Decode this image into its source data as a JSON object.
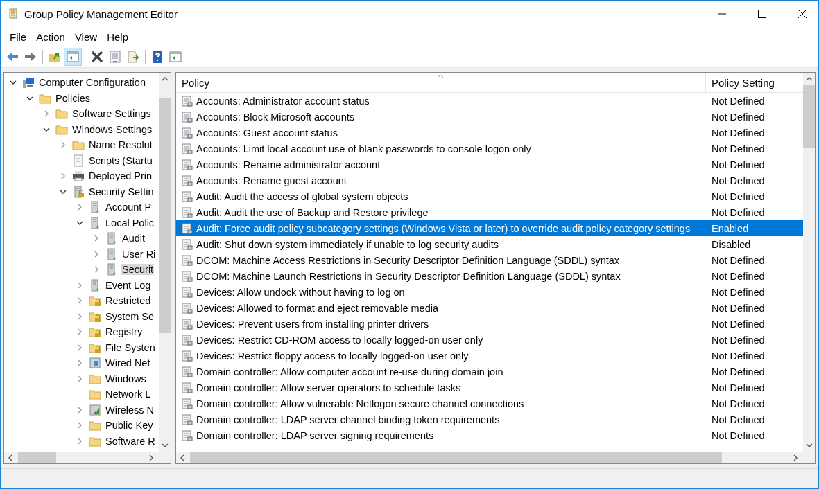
{
  "window": {
    "title": "Group Policy Management Editor"
  },
  "menu": [
    "File",
    "Action",
    "View",
    "Help"
  ],
  "toolbar": [
    {
      "kind": "back"
    },
    {
      "kind": "forward"
    },
    {
      "kind": "sep"
    },
    {
      "kind": "up"
    },
    {
      "kind": "showhide",
      "selected": true
    },
    {
      "kind": "sep"
    },
    {
      "kind": "delete"
    },
    {
      "kind": "properties"
    },
    {
      "kind": "export"
    },
    {
      "kind": "sep"
    },
    {
      "kind": "help"
    },
    {
      "kind": "pane"
    }
  ],
  "tree": [
    {
      "label": "Computer Configuration",
      "kind": "computer",
      "expanded": true,
      "selected": false,
      "children": [
        {
          "label": "Policies",
          "kind": "folder",
          "expanded": true,
          "selected": false,
          "children": [
            {
              "label": "Software Settings",
              "kind": "folder",
              "expanded": false,
              "selected": false
            },
            {
              "label": "Windows Settings",
              "kind": "folder",
              "expanded": true,
              "selected": false,
              "children": [
                {
                  "label": "Name Resolut",
                  "kind": "folder",
                  "expanded": false,
                  "selected": false
                },
                {
                  "label": "Scripts (Startu",
                  "kind": "script",
                  "selected": false
                },
                {
                  "label": "Deployed Prin",
                  "kind": "printer",
                  "expanded": false,
                  "selected": false
                },
                {
                  "label": "Security Settin",
                  "kind": "lockserver",
                  "expanded": true,
                  "selected": false,
                  "children": [
                    {
                      "label": "Account P",
                      "kind": "server",
                      "expanded": false,
                      "selected": false
                    },
                    {
                      "label": "Local Polic",
                      "kind": "server",
                      "expanded": true,
                      "selected": false,
                      "children": [
                        {
                          "label": "Audit",
                          "kind": "server",
                          "expanded": false,
                          "selected": false
                        },
                        {
                          "label": "User Ri",
                          "kind": "server",
                          "expanded": false,
                          "selected": false
                        },
                        {
                          "label": "Securit",
                          "kind": "server",
                          "expanded": false,
                          "selected": true
                        }
                      ]
                    },
                    {
                      "label": "Event Log",
                      "kind": "server",
                      "expanded": false,
                      "selected": false
                    },
                    {
                      "label": "Restricted",
                      "kind": "lockfolder",
                      "expanded": false,
                      "selected": false
                    },
                    {
                      "label": "System Se",
                      "kind": "lockfolder",
                      "expanded": false,
                      "selected": false
                    },
                    {
                      "label": "Registry",
                      "kind": "lockfolder",
                      "expanded": false,
                      "selected": false
                    },
                    {
                      "label": "File Systen",
                      "kind": "lockfolder",
                      "expanded": false,
                      "selected": false
                    },
                    {
                      "label": "Wired Net",
                      "kind": "network",
                      "expanded": false,
                      "selected": false
                    },
                    {
                      "label": "Windows",
                      "kind": "folder",
                      "expanded": false,
                      "selected": false
                    },
                    {
                      "label": "Network L",
                      "kind": "folder",
                      "selected": false
                    },
                    {
                      "label": "Wireless N",
                      "kind": "wireless",
                      "expanded": false,
                      "selected": false
                    },
                    {
                      "label": "Public Key",
                      "kind": "folder",
                      "expanded": false,
                      "selected": false
                    },
                    {
                      "label": "Software R",
                      "kind": "folder",
                      "expanded": false,
                      "selected": false
                    }
                  ]
                }
              ]
            }
          ]
        }
      ]
    }
  ],
  "table": {
    "columns": [
      "Policy",
      "Policy Setting"
    ],
    "rows": [
      {
        "policy": "Accounts: Administrator account status",
        "setting": "Not Defined",
        "selected": false
      },
      {
        "policy": "Accounts: Block Microsoft accounts",
        "setting": "Not Defined",
        "selected": false
      },
      {
        "policy": "Accounts: Guest account status",
        "setting": "Not Defined",
        "selected": false
      },
      {
        "policy": "Accounts: Limit local account use of blank passwords to console logon only",
        "setting": "Not Defined",
        "selected": false
      },
      {
        "policy": "Accounts: Rename administrator account",
        "setting": "Not Defined",
        "selected": false
      },
      {
        "policy": "Accounts: Rename guest account",
        "setting": "Not Defined",
        "selected": false
      },
      {
        "policy": "Audit: Audit the access of global system objects",
        "setting": "Not Defined",
        "selected": false
      },
      {
        "policy": "Audit: Audit the use of Backup and Restore privilege",
        "setting": "Not Defined",
        "selected": false
      },
      {
        "policy": "Audit: Force audit policy subcategory settings (Windows Vista or later) to override audit policy category settings",
        "setting": "Enabled",
        "selected": true
      },
      {
        "policy": "Audit: Shut down system immediately if unable to log security audits",
        "setting": "Disabled",
        "selected": false
      },
      {
        "policy": "DCOM: Machine Access Restrictions in Security Descriptor Definition Language (SDDL) syntax",
        "setting": "Not Defined",
        "selected": false
      },
      {
        "policy": "DCOM: Machine Launch Restrictions in Security Descriptor Definition Language (SDDL) syntax",
        "setting": "Not Defined",
        "selected": false
      },
      {
        "policy": "Devices: Allow undock without having to log on",
        "setting": "Not Defined",
        "selected": false
      },
      {
        "policy": "Devices: Allowed to format and eject removable media",
        "setting": "Not Defined",
        "selected": false
      },
      {
        "policy": "Devices: Prevent users from installing printer drivers",
        "setting": "Not Defined",
        "selected": false
      },
      {
        "policy": "Devices: Restrict CD-ROM access to locally logged-on user only",
        "setting": "Not Defined",
        "selected": false
      },
      {
        "policy": "Devices: Restrict floppy access to locally logged-on user only",
        "setting": "Not Defined",
        "selected": false
      },
      {
        "policy": "Domain controller: Allow computer account re-use during domain join",
        "setting": "Not Defined",
        "selected": false
      },
      {
        "policy": "Domain controller: Allow server operators to schedule tasks",
        "setting": "Not Defined",
        "selected": false
      },
      {
        "policy": "Domain controller: Allow vulnerable Netlogon secure channel connections",
        "setting": "Not Defined",
        "selected": false
      },
      {
        "policy": "Domain controller: LDAP server channel binding token requirements",
        "setting": "Not Defined",
        "selected": false
      },
      {
        "policy": "Domain controller: LDAP server signing requirements",
        "setting": "Not Defined",
        "selected": false
      }
    ]
  }
}
